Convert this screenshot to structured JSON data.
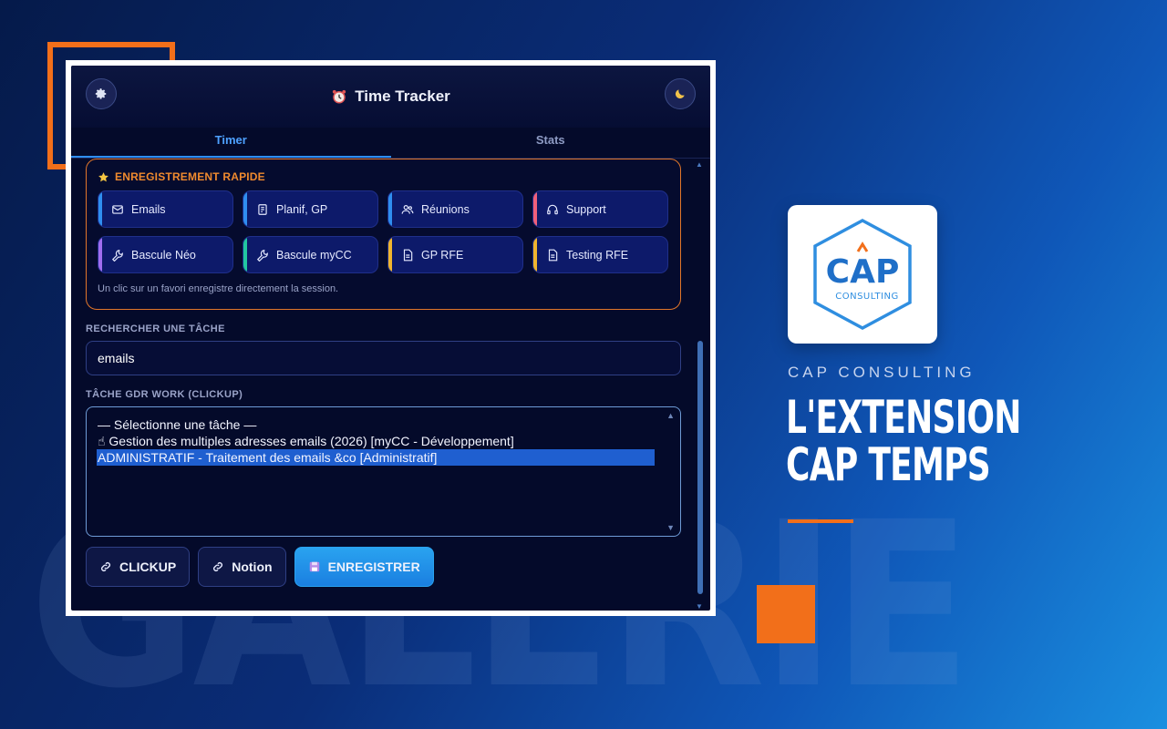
{
  "background": {
    "watermark": "GALERIE",
    "accent_color": "#f26f1a"
  },
  "popup": {
    "title": "Time Tracker",
    "settings_icon": "gear-icon",
    "theme_icon": "moon-icon",
    "tabs": [
      {
        "label": "Timer",
        "active": true
      },
      {
        "label": "Stats",
        "active": false
      }
    ],
    "quick": {
      "title": "ENREGISTREMENT RAPIDE",
      "favorites": [
        {
          "label": "Emails",
          "icon": "mail-icon",
          "accent": "#2f8ef0"
        },
        {
          "label": "Planif, GP",
          "icon": "calendar-icon",
          "accent": "#2f8ef0"
        },
        {
          "label": "Réunions",
          "icon": "users-icon",
          "accent": "#2f8ef0"
        },
        {
          "label": "Support",
          "icon": "headset-icon",
          "accent": "#f0607a"
        },
        {
          "label": "Bascule Néo",
          "icon": "wrench-icon",
          "accent": "#a06df0"
        },
        {
          "label": "Bascule myCC",
          "icon": "wrench-icon",
          "accent": "#22c7a0"
        },
        {
          "label": "GP RFE",
          "icon": "document-icon",
          "accent": "#f0b52e"
        },
        {
          "label": "Testing RFE",
          "icon": "document-icon",
          "accent": "#f0b52e"
        }
      ],
      "hint": "Un clic sur un favori enregistre directement la session."
    },
    "search": {
      "label": "RECHERCHER UNE TÂCHE",
      "value": "emails"
    },
    "task": {
      "label": "TÂCHE GDR WORK (CLICKUP)",
      "options": [
        {
          "text": "— Sélectionne une tâche —",
          "selected": false
        },
        {
          "text": "☝ Gestion des multiples adresses emails (2026) [myCC - Développement]",
          "selected": false
        },
        {
          "text": "ADMINISTRATIF - Traitement des emails &co [Administratif]",
          "selected": true
        }
      ]
    },
    "actions": {
      "clickup": "CLICKUP",
      "notion": "Notion",
      "save": "ENREGISTRER"
    }
  },
  "promo": {
    "logo_main": "CAP",
    "logo_sub": "CONSULTING",
    "brand": "CAP CONSULTING",
    "headline_line1": "L'EXTENSION",
    "headline_line2": "CAP TEMPS"
  }
}
